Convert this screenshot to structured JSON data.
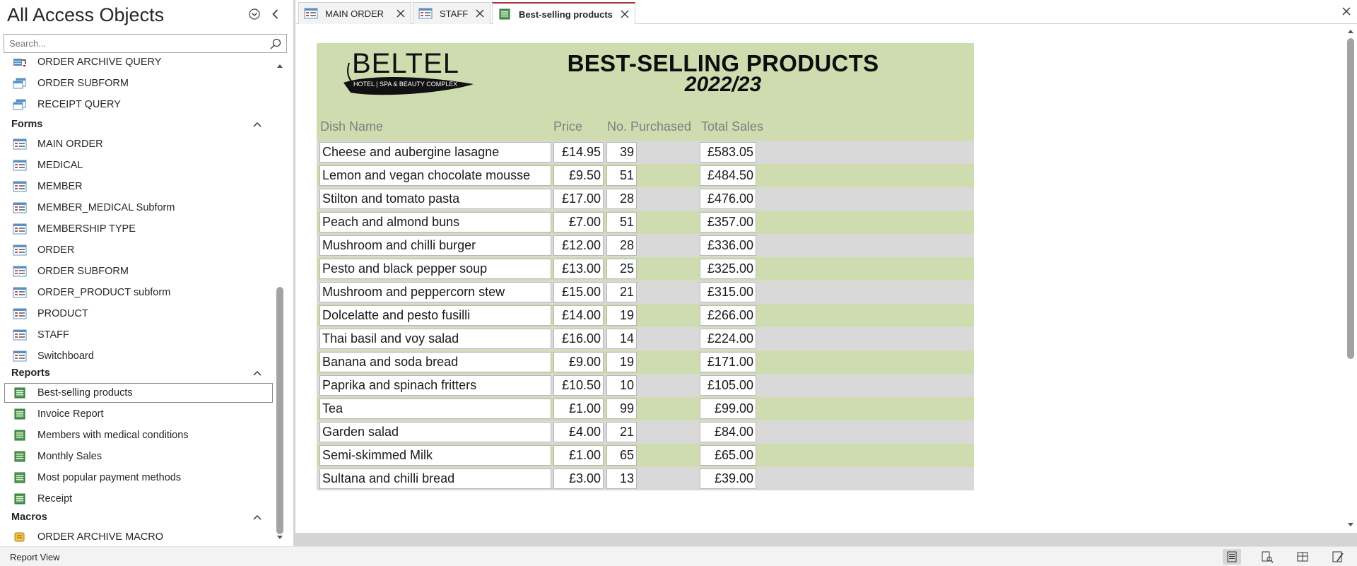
{
  "nav": {
    "title": "All Access Objects",
    "search_placeholder": "Search...",
    "items_top": [
      {
        "label": "ORDER ARCHIVE QUERY",
        "icon": "action-query-icon"
      },
      {
        "label": "ORDER SUBFORM",
        "icon": "query-icon"
      },
      {
        "label": "RECEIPT QUERY",
        "icon": "query-icon"
      }
    ],
    "groups": {
      "forms": "Forms",
      "reports": "Reports",
      "macros": "Macros"
    },
    "forms": [
      {
        "label": "MAIN ORDER"
      },
      {
        "label": "MEDICAL"
      },
      {
        "label": "MEMBER"
      },
      {
        "label": "MEMBER_MEDICAL Subform"
      },
      {
        "label": "MEMBERSHIP TYPE"
      },
      {
        "label": "ORDER"
      },
      {
        "label": "ORDER SUBFORM"
      },
      {
        "label": "ORDER_PRODUCT subform"
      },
      {
        "label": "PRODUCT"
      },
      {
        "label": "STAFF"
      },
      {
        "label": "Switchboard"
      }
    ],
    "reports": [
      {
        "label": "Best-selling products",
        "selected": true
      },
      {
        "label": "Invoice Report"
      },
      {
        "label": "Members with medical conditions"
      },
      {
        "label": "Monthly Sales"
      },
      {
        "label": "Most popular payment methods"
      },
      {
        "label": "Receipt"
      }
    ],
    "macros": [
      {
        "label": "ORDER ARCHIVE MACRO"
      }
    ]
  },
  "tabs": [
    {
      "label": "MAIN ORDER",
      "icon": "form-icon"
    },
    {
      "label": "STAFF",
      "icon": "form-icon"
    },
    {
      "label": "Best-selling products",
      "icon": "report-icon",
      "active": true
    }
  ],
  "report": {
    "logo_text": "BELTEL",
    "logo_tagline": "HOTEL | SPA & BEAUTY COMPLEX",
    "title": "BEST-SELLING PRODUCTS",
    "subtitle": "2022/23",
    "columns": {
      "name": "Dish Name",
      "price": "Price",
      "qty": "No. Purchased",
      "total": "Total Sales"
    },
    "rows": [
      {
        "name": "Cheese and aubergine lasagne",
        "price": "£14.95",
        "qty": "39",
        "total": "£583.05"
      },
      {
        "name": "Lemon and vegan chocolate mousse",
        "price": "£9.50",
        "qty": "51",
        "total": "£484.50"
      },
      {
        "name": "Stilton and tomato pasta",
        "price": "£17.00",
        "qty": "28",
        "total": "£476.00"
      },
      {
        "name": "Peach and almond buns",
        "price": "£7.00",
        "qty": "51",
        "total": "£357.00"
      },
      {
        "name": "Mushroom and chilli burger",
        "price": "£12.00",
        "qty": "28",
        "total": "£336.00"
      },
      {
        "name": "Pesto and black pepper soup",
        "price": "£13.00",
        "qty": "25",
        "total": "£325.00"
      },
      {
        "name": "Mushroom and peppercorn stew",
        "price": "£15.00",
        "qty": "21",
        "total": "£315.00"
      },
      {
        "name": "Dolcelatte and pesto fusilli",
        "price": "£14.00",
        "qty": "19",
        "total": "£266.00"
      },
      {
        "name": "Thai basil and voy salad",
        "price": "£16.00",
        "qty": "14",
        "total": "£224.00"
      },
      {
        "name": "Banana and soda bread",
        "price": "£9.00",
        "qty": "19",
        "total": "£171.00"
      },
      {
        "name": "Paprika and spinach fritters",
        "price": "£10.50",
        "qty": "10",
        "total": "£105.00"
      },
      {
        "name": "Tea",
        "price": "£1.00",
        "qty": "99",
        "total": "£99.00"
      },
      {
        "name": "Garden salad",
        "price": "£4.00",
        "qty": "21",
        "total": "£84.00"
      },
      {
        "name": "Semi-skimmed Milk",
        "price": "£1.00",
        "qty": "65",
        "total": "£65.00"
      },
      {
        "name": "Sultana and chilli bread",
        "price": "£3.00",
        "qty": "13",
        "total": "£39.00"
      }
    ]
  },
  "status": {
    "text": "Report View"
  },
  "colors": {
    "report_green": "#cedcb0",
    "report_gray": "#d9d9d9",
    "active_tab_accent": "#a4373a"
  }
}
